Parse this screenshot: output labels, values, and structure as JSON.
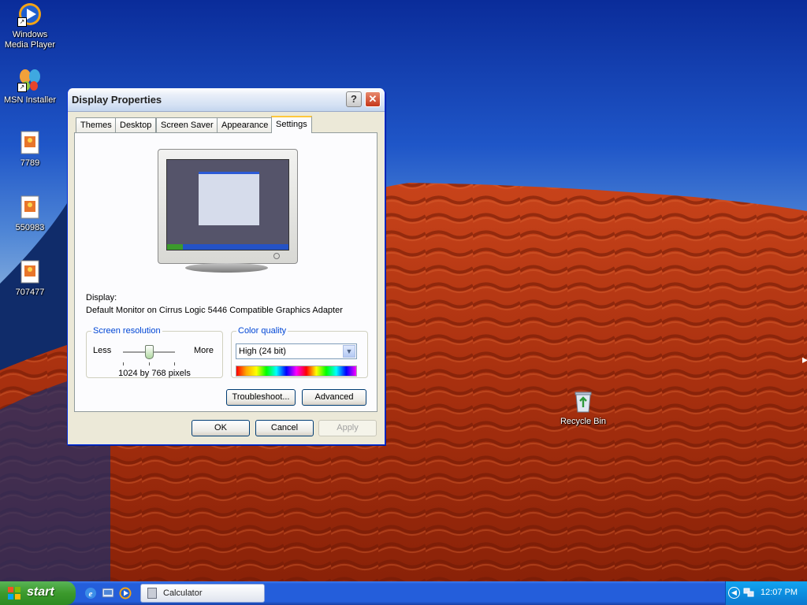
{
  "desktop": {
    "icons": [
      {
        "label": "Windows Media Player",
        "icon": "windows-media-player-icon"
      },
      {
        "label": "MSN Installer",
        "icon": "msn-butterfly-icon"
      },
      {
        "label": "7789",
        "icon": "image-file-icon"
      },
      {
        "label": "550983",
        "icon": "image-file-icon"
      },
      {
        "label": "707477",
        "icon": "image-file-icon"
      },
      {
        "label": "Recycle Bin",
        "icon": "recycle-bin-icon"
      }
    ]
  },
  "dialog": {
    "title": "Display Properties",
    "help_glyph": "?",
    "close_glyph": "✕",
    "tabs": [
      {
        "label": "Themes"
      },
      {
        "label": "Desktop"
      },
      {
        "label": "Screen Saver"
      },
      {
        "label": "Appearance"
      },
      {
        "label": "Settings",
        "active": true
      }
    ],
    "display_label": "Display:",
    "display_value": "Default Monitor on Cirrus Logic 5446 Compatible Graphics Adapter",
    "resolution": {
      "legend": "Screen resolution",
      "less_label": "Less",
      "more_label": "More",
      "value_text": "1024 by 768 pixels",
      "slider_fraction": 0.5
    },
    "color_quality": {
      "legend": "Color quality",
      "selected": "High (24 bit)"
    },
    "buttons": {
      "troubleshoot": "Troubleshoot...",
      "advanced": "Advanced",
      "ok": "OK",
      "cancel": "Cancel",
      "apply": "Apply"
    }
  },
  "taskbar": {
    "start_label": "start",
    "quick_launch": [
      "internet-explorer-icon",
      "show-desktop-icon",
      "media-player-icon"
    ],
    "tasks": [
      {
        "label": "Calculator",
        "icon": "calculator-icon"
      }
    ],
    "clock": "12:07 PM"
  },
  "colors": {
    "titlebar_text": "#222222",
    "legend_text": "#0046d5",
    "active_tab_accent": "#ffc83c",
    "taskbar_blue": "#245edb",
    "start_green": "#3c9a2c"
  }
}
